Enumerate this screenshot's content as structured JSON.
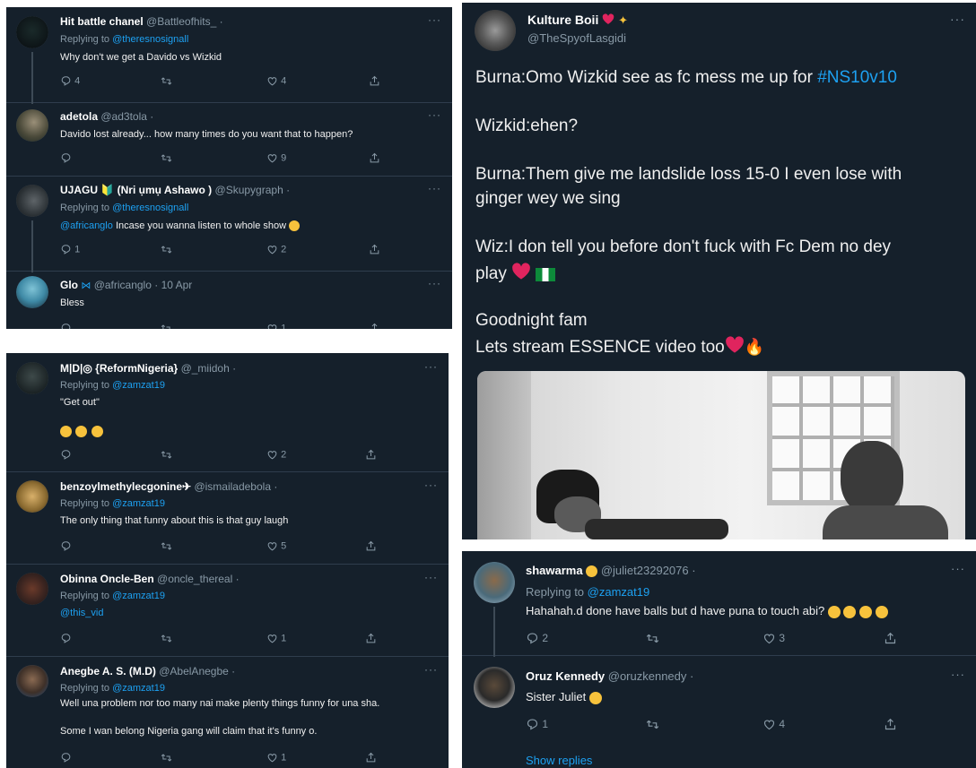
{
  "panel1": {
    "tweets": [
      {
        "name": "Hit battle chanel",
        "handle": "@Battleofhits_ ·",
        "reply_label": "Replying to",
        "reply_to": "@theresnosignall",
        "text": "Why don't we get a Davido vs Wizkid",
        "replies": "4",
        "retweets": "",
        "likes": "4"
      },
      {
        "name": "adetola",
        "handle": "@ad3tola ·",
        "text": "Davido lost already... how many times do you want that to happen?",
        "replies": "",
        "retweets": "",
        "likes": "9"
      },
      {
        "name": "UJAGU 🔰 (Nri ụmụ Ashawo )",
        "handle": "@Skupygraph ·",
        "reply_label": "Replying to",
        "reply_to": "@theresnosignall",
        "mention": "@africanglo",
        "text": "Incase you wanna listen to whole show",
        "replies": "1",
        "retweets": "",
        "likes": "2"
      },
      {
        "name": "Glo",
        "handle": "@africanglo · 10 Apr",
        "text": "Bless",
        "replies": "",
        "retweets": "",
        "likes": "1"
      }
    ]
  },
  "panel2": {
    "tweets": [
      {
        "name": "M|D|◎ {ReformNigeria}",
        "handle": "@_miidoh ·",
        "reply_label": "Replying to",
        "reply_to": "@zamzat19",
        "text": "\"Get out\"",
        "replies": "",
        "retweets": "",
        "likes": "2"
      },
      {
        "name": "benzoylmethylecgonine✈",
        "handle": "@ismailadebola ·",
        "reply_label": "Replying to",
        "reply_to": "@zamzat19",
        "text": "The only thing that funny about this is that guy laugh",
        "replies": "",
        "retweets": "",
        "likes": "5"
      },
      {
        "name": "Obinna Oncle-Ben",
        "handle": "@oncle_thereal ·",
        "reply_label": "Replying to",
        "reply_to": "@zamzat19",
        "text": "@this_vid",
        "replies": "",
        "retweets": "",
        "likes": "1"
      },
      {
        "name": "Anegbe A. S. (M.D)",
        "handle": "@AbelAnegbe ·",
        "reply_label": "Replying to",
        "reply_to": "@zamzat19",
        "text": "Well una problem nor too many nai make plenty things funny for una sha.",
        "text2": "Some I wan belong Nigeria gang will claim that it's funny o.",
        "replies": "",
        "retweets": "",
        "likes": "1"
      }
    ]
  },
  "panel3": {
    "name": "Kulture Boii",
    "handle": "@TheSpyofLasgidi",
    "line1": "Burna:Omo Wizkid see as fc mess me up for ",
    "hashtag": "#NS10v10",
    "line2": "Wizkid:ehen?",
    "line3a": "Burna:Them give me landslide loss 15-0 I even lose with",
    "line3b": "ginger wey we sing",
    "line4a": "Wiz:I don tell you before don't fuck with Fc Dem no dey",
    "line4b": "play",
    "line5a": "Goodnight fam",
    "line5b": "Lets stream ESSENCE video too"
  },
  "panel4": {
    "tweets": [
      {
        "name": "shawarma",
        "handle": "@juliet23292076 ·",
        "reply_label": "Replying to",
        "reply_to": "@zamzat19",
        "text": "Hahahah.d done have balls but d have puna to touch abi?",
        "replies": "2",
        "retweets": "",
        "likes": "3"
      },
      {
        "name": "Oruz Kennedy",
        "handle": "@oruzkennedy ·",
        "text": "Sister Juliet",
        "replies": "1",
        "retweets": "",
        "likes": "4"
      }
    ],
    "show_replies": "Show replies"
  },
  "icons": [
    "reply-icon",
    "retweet-icon",
    "like-icon",
    "share-icon",
    "more-icon",
    "verified-blue-flag-icon"
  ],
  "colors": {
    "background": "#15202b",
    "link": "#1da1f2",
    "muted": "#8899a6"
  }
}
